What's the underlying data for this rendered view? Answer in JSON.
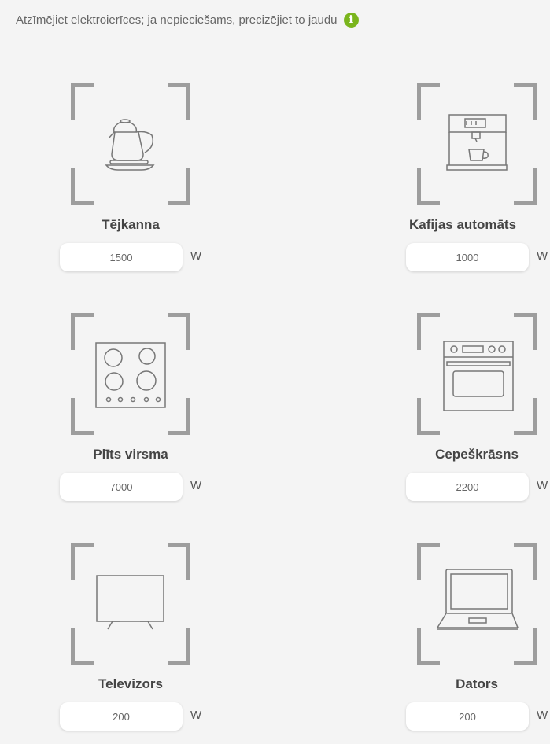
{
  "instruction": {
    "text": "Atzīmējiet elektroierīces; ja nepieciešams, precizējiet to jaudu",
    "info_icon_glyph": "i"
  },
  "colors": {
    "accent_green": "#7ab51d",
    "frame_gray": "#9d9d9d",
    "panel_bg": "#f4f4f4"
  },
  "appliances": [
    {
      "name": "Tējkanna",
      "power": "1500",
      "unit": "W",
      "icon": "kettle-icon"
    },
    {
      "name": "Kafijas automāts",
      "power": "1000",
      "unit": "W",
      "icon": "coffee-machine-icon"
    },
    {
      "name": "Plīts virsma",
      "power": "7000",
      "unit": "W",
      "icon": "cooktop-icon"
    },
    {
      "name": "Cepeškrāsns",
      "power": "2200",
      "unit": "W",
      "icon": "oven-icon"
    },
    {
      "name": "Televizors",
      "power": "200",
      "unit": "W",
      "icon": "tv-icon"
    },
    {
      "name": "Dators",
      "power": "200",
      "unit": "W",
      "icon": "laptop-icon"
    }
  ]
}
